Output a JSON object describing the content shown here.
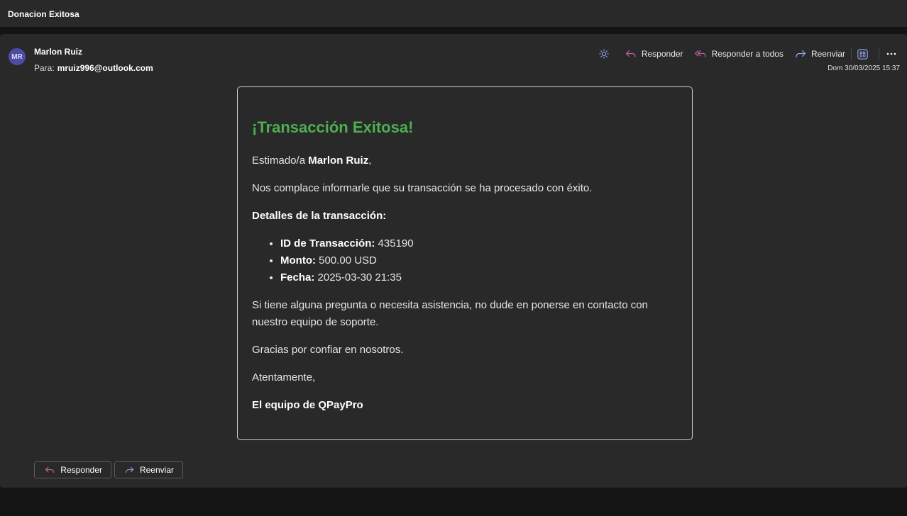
{
  "subject": "Donacion Exitosa",
  "message": {
    "avatar_initials": "MR",
    "sender_name": "Marlon Ruiz",
    "to_label": "Para:",
    "to_address": "mruiz996@outlook.com",
    "date": "Dom 30/03/2025 15:37",
    "actions": {
      "reply": "Responder",
      "reply_all": "Responder a todos",
      "forward": "Reenviar"
    }
  },
  "body": {
    "title": "¡Transacción Exitosa!",
    "greeting_prefix": "Estimado/a ",
    "greeting_name": "Marlon Ruiz",
    "greeting_suffix": ",",
    "intro": "Nos complace informarle que su transacción se ha procesado con éxito.",
    "details_heading": "Detalles de la transacción:",
    "details": [
      {
        "label": "ID de Transacción:",
        "value": " 435190"
      },
      {
        "label": "Monto:",
        "value": " 500.00 USD"
      },
      {
        "label": "Fecha:",
        "value": " 2025-03-30 21:35"
      }
    ],
    "support_line1": "Si tiene alguna pregunta o necesita asistencia, no dude en ponerse en contacto con",
    "support_line2": "nuestro equipo de soporte.",
    "thanks": "Gracias por confiar en nosotros.",
    "closing": "Atentamente,",
    "signature": "El equipo de QPayPro"
  },
  "footer": {
    "reply": "Responder",
    "forward": "Reenviar"
  },
  "colors": {
    "accent_green": "#4caf50",
    "reply_icon": "#c25fa8",
    "forward_icon": "#8fa6f0",
    "avatar_bg": "#4d4ba3"
  }
}
